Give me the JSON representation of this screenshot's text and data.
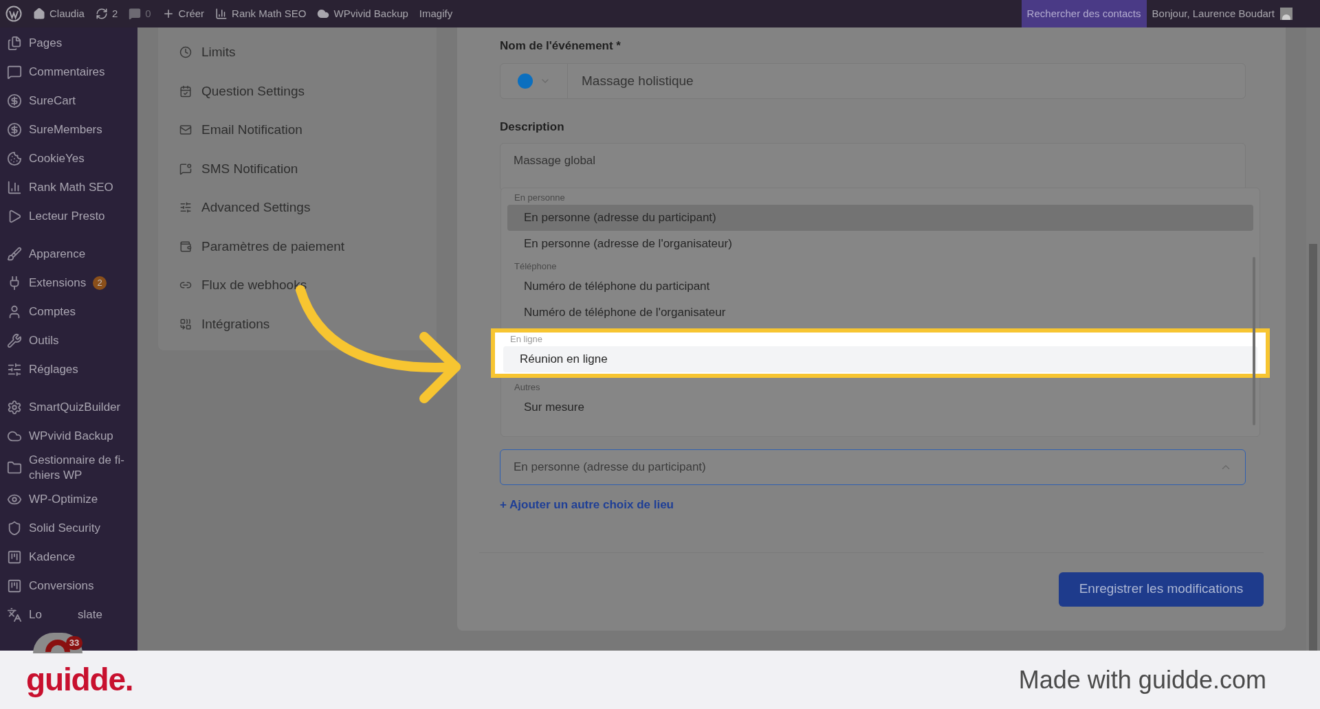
{
  "admin_bar": {
    "items": [
      {
        "kind": "logo"
      },
      {
        "kind": "home",
        "label": "Claudia"
      },
      {
        "kind": "updates",
        "label": "2"
      },
      {
        "kind": "comments",
        "label": "0"
      },
      {
        "kind": "new",
        "label": "Créer"
      },
      {
        "kind": "chart",
        "label": "Rank Math SEO"
      },
      {
        "kind": "cloud",
        "label": "WPvivid Backup"
      },
      {
        "kind": "text",
        "label": "Imagify"
      }
    ],
    "search_contacts": "Rechercher des contacts",
    "greeting": "Bonjour, Laurence Boudart"
  },
  "sidebar": {
    "groups": [
      [
        {
          "label": "Pages"
        },
        {
          "label": "Commentaires"
        },
        {
          "label": "SureCart"
        },
        {
          "label": "SureMembers"
        },
        {
          "label": "CookieYes"
        },
        {
          "label": "Rank Math SEO"
        },
        {
          "label": "Lecteur Presto"
        }
      ],
      [
        {
          "label": "Apparence"
        },
        {
          "label": "Extensions",
          "badge": "2"
        },
        {
          "label": "Comptes"
        },
        {
          "label": "Outils"
        },
        {
          "label": "Réglages"
        }
      ],
      [
        {
          "label": "SmartQuizBuilder"
        },
        {
          "label": "WPvivid Backup"
        },
        {
          "label": "Gestionnaire de fi-chiers WP"
        },
        {
          "label": "WP-Optimize"
        },
        {
          "label": "Solid Security"
        },
        {
          "label": "Kadence"
        },
        {
          "label": "Conversions"
        },
        {
          "label": "Lo",
          "label_end": "slate"
        }
      ]
    ]
  },
  "chat_widget": {
    "badge": "33"
  },
  "settings_menu": [
    {
      "label": "Limits"
    },
    {
      "label": "Question Settings"
    },
    {
      "label": "Email Notification"
    },
    {
      "label": "SMS Notification"
    },
    {
      "label": "Advanced Settings"
    },
    {
      "label": "Paramètres de paiement"
    },
    {
      "label": "Flux de webhooks"
    },
    {
      "label": "Intégrations"
    }
  ],
  "form": {
    "name_label": "Nom de l'événement *",
    "name_value": "Massage holistique",
    "description_label": "Description",
    "description_value": "Massage global",
    "location_value": "En personne (adresse du participant)",
    "add_location": "+ Ajouter un autre choix de lieu",
    "save": "Enregistrer les modifications"
  },
  "location_dropdown": {
    "groups": [
      {
        "header": "En personne",
        "spotlight": false,
        "options": [
          {
            "label": "En personne (adresse du participant)",
            "highlighted": true
          },
          {
            "label": "En personne (adresse de l'organisateur)",
            "highlighted": false
          }
        ]
      },
      {
        "header": "Téléphone",
        "spotlight": false,
        "options": [
          {
            "label": "Numéro de téléphone du participant",
            "highlighted": false
          },
          {
            "label": "Numéro de téléphone de l'organisateur",
            "highlighted": false
          }
        ]
      },
      {
        "header": "En ligne",
        "spotlight": true,
        "options": [
          {
            "label": "Réunion en ligne",
            "highlighted": true
          }
        ]
      },
      {
        "header": "Autres",
        "spotlight": false,
        "options": [
          {
            "label": "Sur mesure",
            "highlighted": false
          }
        ]
      }
    ]
  },
  "footer": {
    "brand": "guidde.",
    "tagline": "Made with guidde.com"
  }
}
